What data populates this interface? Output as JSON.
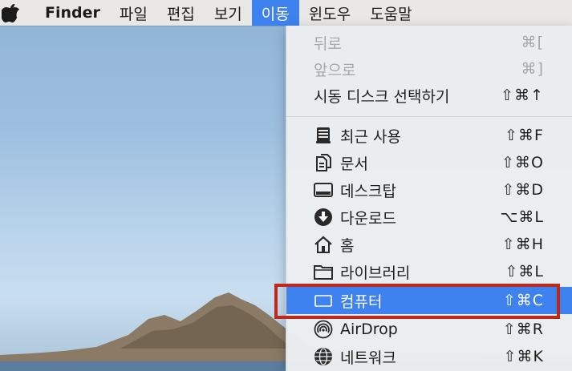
{
  "menubar": {
    "app": "Finder",
    "items": [
      "파일",
      "편집",
      "보기",
      "이동",
      "윈도우",
      "도움말"
    ],
    "active": "이동",
    "accent": "#3e82ef"
  },
  "go_menu": {
    "back": {
      "label": "뒤로",
      "shortcut": "⌘["
    },
    "forward": {
      "label": "앞으로",
      "shortcut": "⌘]"
    },
    "startup": {
      "label": "시동 디스크 선택하기",
      "shortcut": "⇧⌘↑"
    },
    "items": [
      {
        "label": "최근 사용",
        "shortcut": "⇧⌘F",
        "icon": "recents-icon"
      },
      {
        "label": "문서",
        "shortcut": "⇧⌘O",
        "icon": "documents-icon"
      },
      {
        "label": "데스크탑",
        "shortcut": "⇧⌘D",
        "icon": "desktop-icon"
      },
      {
        "label": "다운로드",
        "shortcut": "⌥⌘L",
        "icon": "downloads-icon"
      },
      {
        "label": "홈",
        "shortcut": "⇧⌘H",
        "icon": "home-icon"
      },
      {
        "label": "라이브러리",
        "shortcut": "⇧⌘L",
        "icon": "folder-icon"
      },
      {
        "label": "컴퓨터",
        "shortcut": "⇧⌘C",
        "icon": "computer-icon"
      },
      {
        "label": "AirDrop",
        "shortcut": "⇧⌘R",
        "icon": "airdrop-icon"
      },
      {
        "label": "네트워크",
        "shortcut": "⇧⌘K",
        "icon": "network-icon"
      }
    ],
    "highlighted": "컴퓨터"
  },
  "annotation_color": "#c0281c"
}
